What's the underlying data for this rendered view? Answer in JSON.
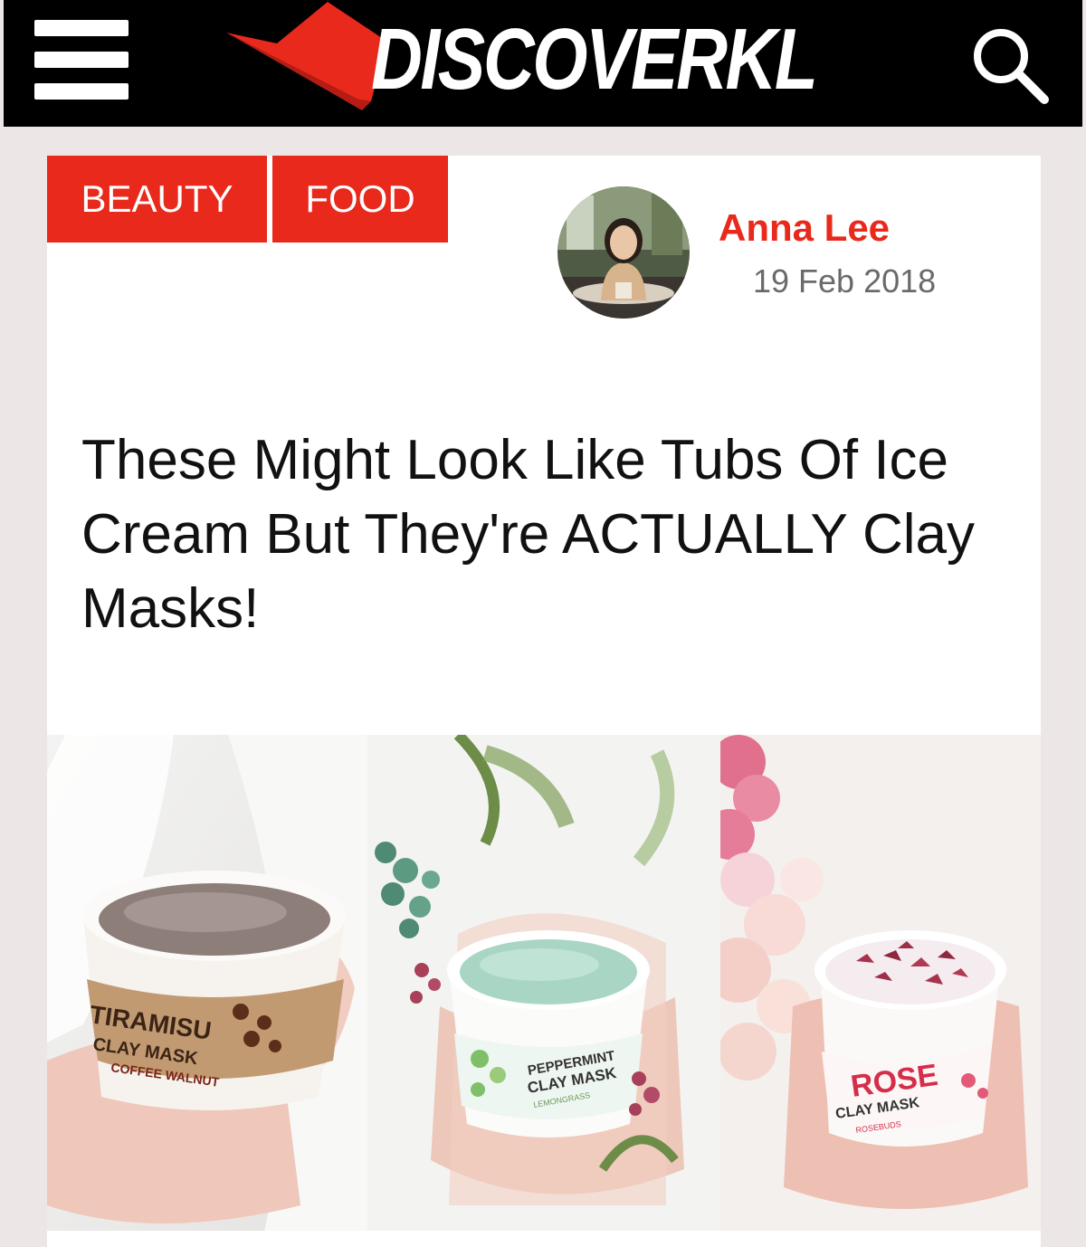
{
  "header": {
    "logo_text": "DISCOVERKL",
    "menu_icon": "hamburger-menu-icon",
    "search_icon": "search-icon"
  },
  "article": {
    "categories": [
      "BEAUTY",
      "FOOD"
    ],
    "author": {
      "name": "Anna Lee",
      "date": "19 Feb 2018"
    },
    "title": "These Might Look Like Tubs Of Ice Cream But They're ACTUALLY Clay Masks!",
    "image": {
      "panels": [
        {
          "label_main": "TIRAMISU",
          "label_sub": "CLAY MASK",
          "label_extra": "COFFEE WALNUT"
        },
        {
          "label_main": "PEPPERMINT",
          "label_sub": "CLAY MASK",
          "label_extra": "LEMONGRASS"
        },
        {
          "label_main": "ROSE",
          "label_sub": "CLAY MASK",
          "label_extra": "ROSEBUDS"
        }
      ]
    }
  },
  "colors": {
    "accent": "#e8291c",
    "topbar": "#000000",
    "page_bg": "#ede6e6"
  }
}
